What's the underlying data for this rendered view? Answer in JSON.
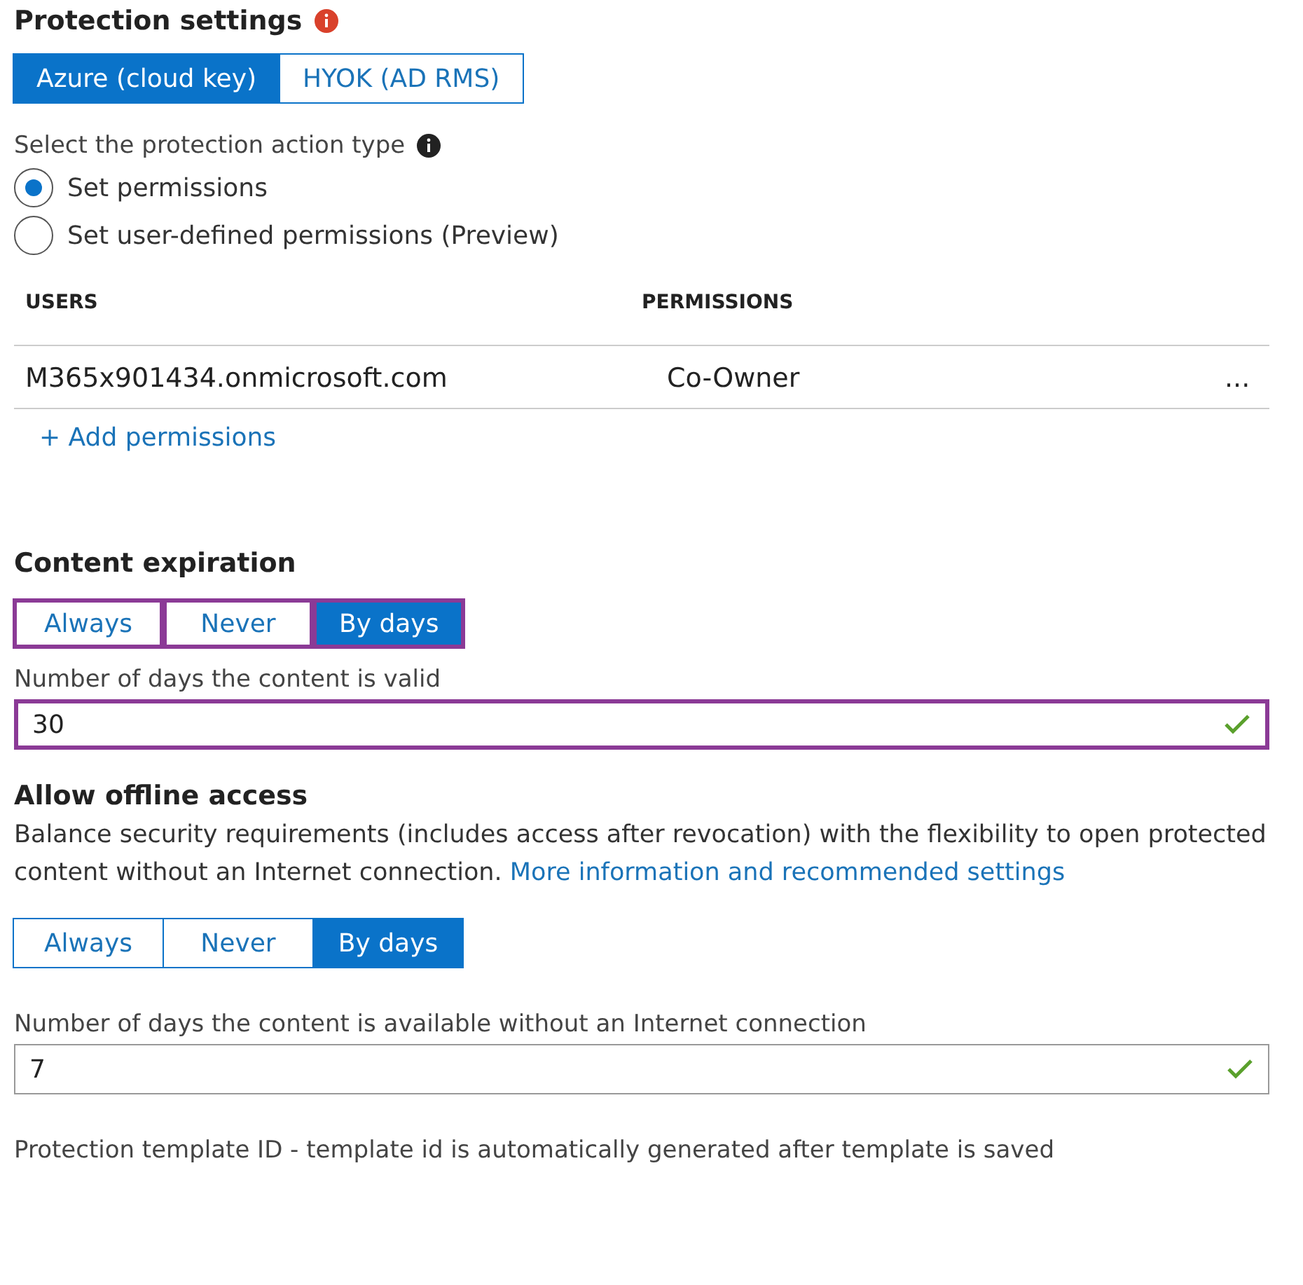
{
  "protection": {
    "title": "Protection settings",
    "key_options": [
      {
        "label": "Azure (cloud key)",
        "selected": true
      },
      {
        "label": "HYOK (AD RMS)",
        "selected": false
      }
    ],
    "action_label": "Select the protection action type",
    "actions": [
      {
        "label": "Set permissions",
        "selected": true
      },
      {
        "label": "Set user-defined permissions (Preview)",
        "selected": false
      }
    ]
  },
  "table": {
    "columns": [
      "USERS",
      "PERMISSIONS"
    ],
    "rows": [
      {
        "user": "M365x901434.onmicrosoft.com",
        "permission": "Co-Owner",
        "more": "..."
      }
    ],
    "add_link": "+ Add permissions"
  },
  "content_expiration": {
    "title": "Content expiration",
    "highlighted": true,
    "options": [
      {
        "label": "Always",
        "selected": false
      },
      {
        "label": "Never",
        "selected": false
      },
      {
        "label": "By days",
        "selected": true
      }
    ],
    "field_label": "Number of days the content is valid",
    "value": "30",
    "valid": true
  },
  "offline_access": {
    "title": "Allow offline access",
    "description": "Balance security requirements (includes access after revocation) with the flexibility to open protected content without an Internet connection.",
    "link": "More information and recommended settings",
    "highlighted": false,
    "options": [
      {
        "label": "Always",
        "selected": false
      },
      {
        "label": "Never",
        "selected": false
      },
      {
        "label": "By days",
        "selected": true
      }
    ],
    "field_label": "Number of days the content is available without an Internet connection",
    "value": "7",
    "valid": true
  },
  "footer_note": "Protection template ID - template id is automatically generated after template is saved"
}
